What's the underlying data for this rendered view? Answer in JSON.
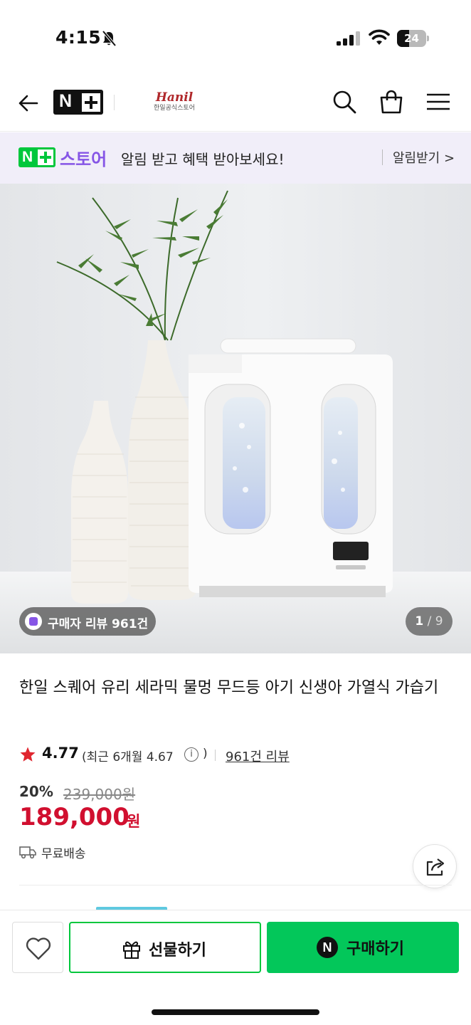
{
  "status_bar": {
    "time": "4:15",
    "battery": "24"
  },
  "header": {
    "naver_plus_letter": "N",
    "brand_script": "Hanil",
    "brand_name": "한일공식스토어"
  },
  "promo": {
    "letter": "N",
    "store_label": "스토어",
    "message": "알림 받고 혜택 받아보세요!",
    "action_label": "알림받기 >"
  },
  "hero": {
    "review_chip": "구매자 리뷰 961건",
    "pager_current": "1",
    "pager_total": "/ 9"
  },
  "product": {
    "title": "한일 스퀘어 유리 세라믹 물멍 무드등 아기 신생아 가열식 가습기",
    "score": "4.77",
    "recent_rating": "(최근 6개월 4.67",
    "info_glyph": "i",
    "recent_close": ")",
    "review_link": "961건 리뷰",
    "discount": "20%",
    "original_price": "239,000원",
    "price": "189,000",
    "currency": "원",
    "shipping": "무료배송"
  },
  "bottom_bar": {
    "gift_label": "선물하기",
    "buy_icon_letter": "N",
    "buy_label": "구매하기"
  },
  "colors": {
    "naver_green": "#03c75a",
    "price_red": "#d10f2f",
    "store_purple": "#8655e6"
  }
}
